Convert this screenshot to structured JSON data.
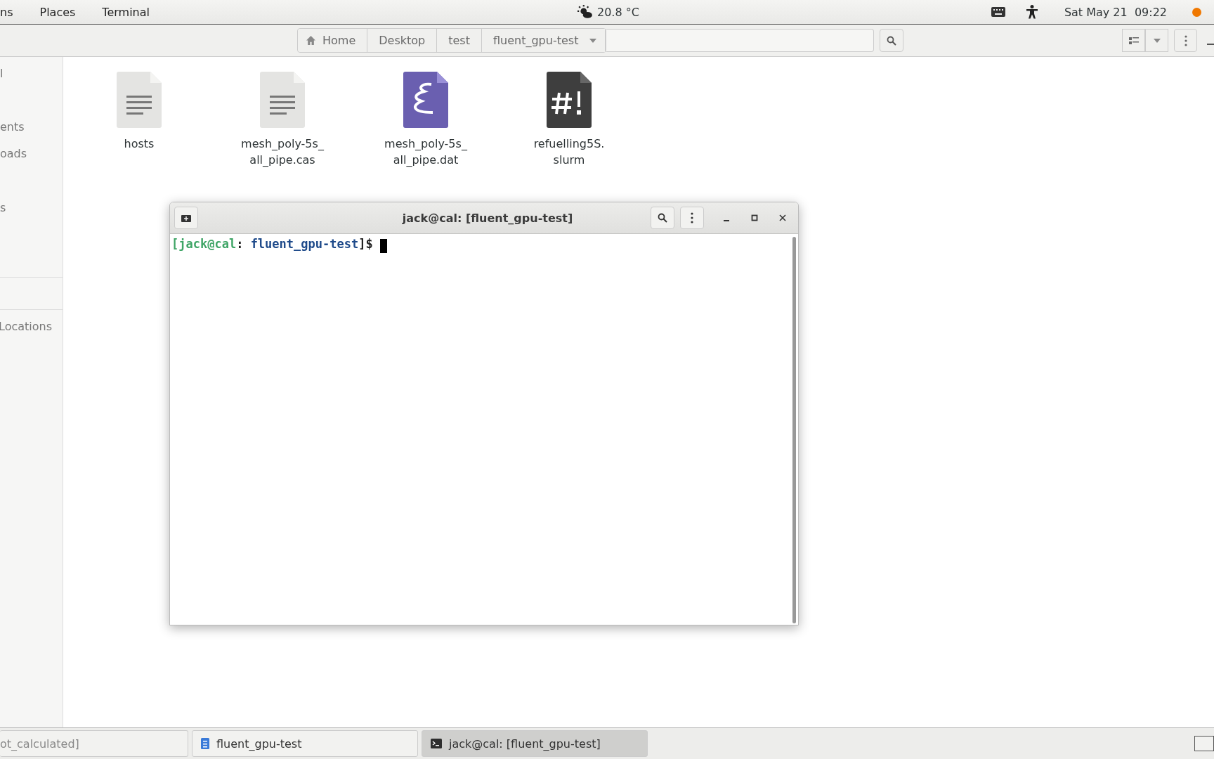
{
  "top_bar": {
    "menus": [
      "ns",
      "Places",
      "Terminal"
    ],
    "weather": "20.8 °C",
    "clock": "Sat May 21  09:22"
  },
  "path_bar": [
    {
      "label": "Home",
      "kind": "home"
    },
    {
      "label": "Desktop",
      "kind": "plain"
    },
    {
      "label": "test",
      "kind": "plain"
    },
    {
      "label": "fluent_gpu-test",
      "kind": "dropdown"
    }
  ],
  "sidebar": {
    "items": [
      "l",
      "ents",
      "oads",
      "s"
    ],
    "section": "Locations"
  },
  "files": [
    {
      "name": "hosts",
      "kind": "text"
    },
    {
      "name": "mesh_poly-5s_ all_pipe.cas",
      "kind": "text"
    },
    {
      "name": "mesh_poly-5s_ all_pipe.dat",
      "kind": "emacs"
    },
    {
      "name": "refuelling5S. slurm",
      "kind": "script"
    }
  ],
  "terminal": {
    "title": "jack@cal: [fluent_gpu-test]",
    "prompt": [
      {
        "text": "[",
        "kind": "user"
      },
      {
        "text": "jack@cal",
        "kind": "user"
      },
      {
        "text": ": ",
        "kind": "plain"
      },
      {
        "text": "fluent_gpu-test",
        "kind": "path"
      },
      {
        "text": "]$ ",
        "kind": "plain"
      }
    ]
  },
  "taskbar": [
    {
      "label": "ot_calculated]",
      "kind": "none",
      "selected": false
    },
    {
      "label": "fluent_gpu-test",
      "kind": "files",
      "selected": false
    },
    {
      "label": "jack@cal: [fluent_gpu-test]",
      "kind": "terminal",
      "selected": true
    }
  ]
}
